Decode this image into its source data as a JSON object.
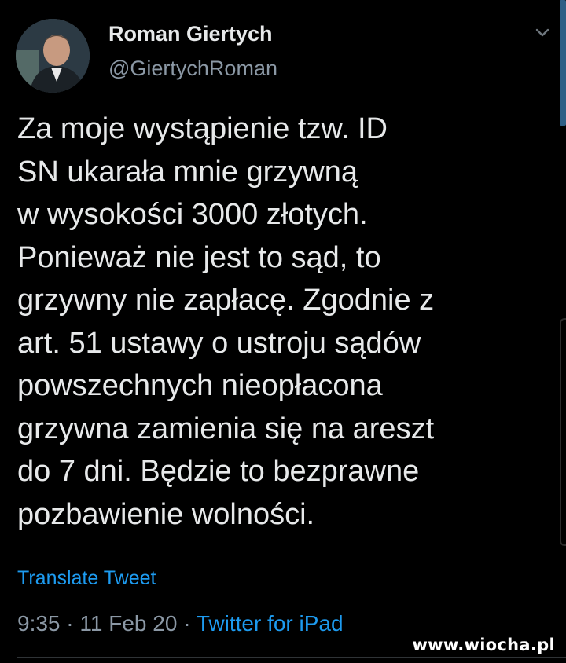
{
  "author": {
    "name": "Roman Giertych",
    "handle": "@GiertychRoman"
  },
  "tweet": {
    "text": "Za moje wystąpienie tzw. ID\nSN ukarała mnie grzywną\nw wysokości 3000 złotych.\nPonieważ nie jest to sąd, to\ngrzywny nie zapłacę. Zgodnie z\nart. 51 ustawy o ustroju sądów\npowszechnych nieopłacona\ngrzywna zamienia się na areszt\ndo 7 dni. Będzie to bezprawne\npozbawienie wolności.",
    "translate_label": "Translate Tweet",
    "time": "9:35",
    "separator": " · ",
    "date": "11 Feb 20",
    "source": "Twitter for iPad"
  },
  "icons": {
    "more": "chevron-down-icon",
    "avatar": "avatar-photo"
  },
  "watermark": "www.wiocha.pl",
  "colors": {
    "background": "#000000",
    "text": "#e7e9ea",
    "muted": "#8b98a5",
    "link": "#1d9bf0"
  }
}
